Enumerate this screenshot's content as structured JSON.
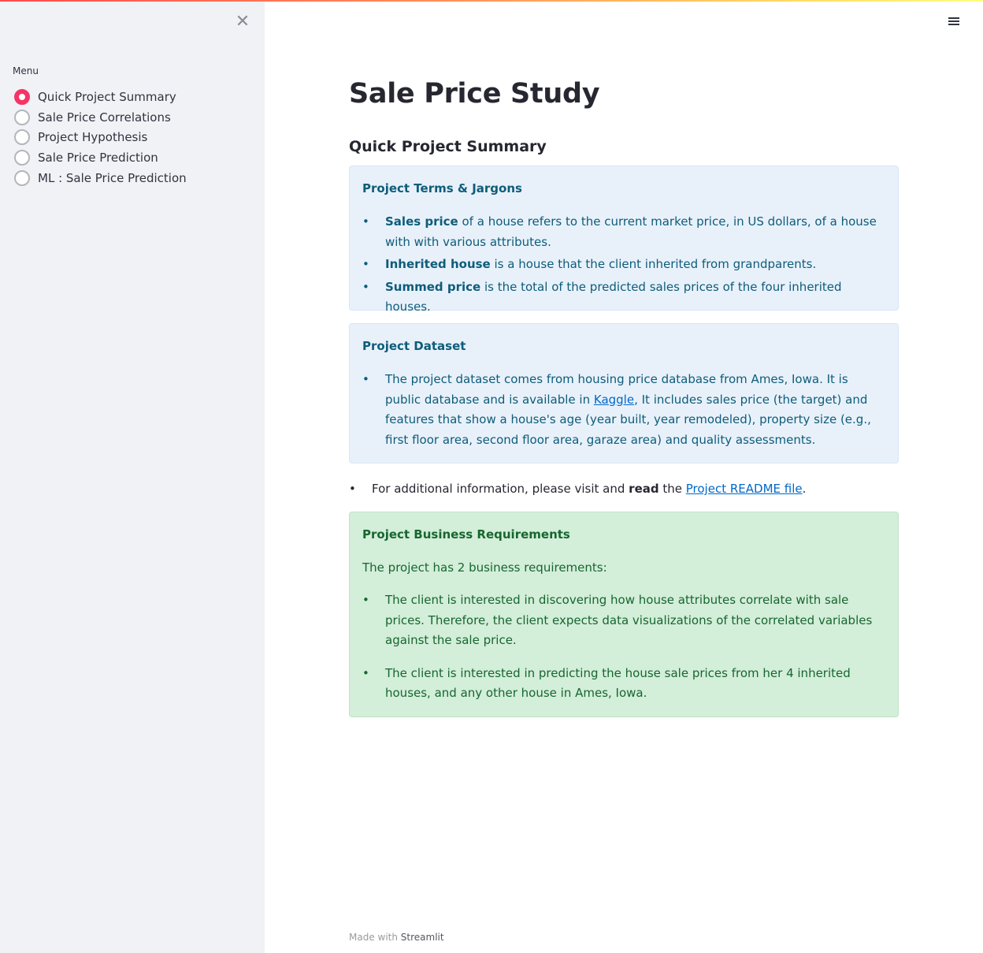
{
  "sidebar": {
    "close_glyph": "✕",
    "menu_label": "Menu",
    "items": [
      {
        "label": "Quick Project Summary",
        "selected": true
      },
      {
        "label": "Sale Price Correlations",
        "selected": false
      },
      {
        "label": "Project Hypothesis",
        "selected": false
      },
      {
        "label": "Sale Price Prediction",
        "selected": false
      },
      {
        "label": "ML : Sale Price Prediction",
        "selected": false
      }
    ]
  },
  "header": {
    "menu_icon": "hamburger-icon"
  },
  "main": {
    "title": "Sale Price Study",
    "section_title": "Quick Project Summary",
    "terms_box": {
      "title": "Project Terms & Jargons",
      "items": [
        {
          "bold": "Sales price",
          "text": " of a house refers to the current market price, in US dollars, of a house with with various attributes."
        },
        {
          "bold": "Inherited house",
          "text": " is a house that the client inherited from grandparents."
        },
        {
          "bold": "Summed price",
          "text": " is the total of the predicted sales prices of the four inherited houses."
        }
      ]
    },
    "dataset_box": {
      "title": "Project Dataset",
      "text_before": "The project dataset comes from housing price database from Ames, Iowa. It is public database and is available in ",
      "link": "Kaggle",
      "text_after": ", It includes sales price (the target) and features that show a house's age (year built, year remodeled), property size (e.g., first floor area, second floor area, garaze area) and quality assessments."
    },
    "additional": {
      "before": "For additional information, please visit and ",
      "bold": "read",
      "middle": " the ",
      "link": "Project README file",
      "after": "."
    },
    "requirements_box": {
      "title": "Project Business Requirements",
      "intro": "The project has 2 business requirements:",
      "items": [
        "The client is interested in discovering how house attributes correlate with sale prices. Therefore, the client expects data visualizations of the correlated variables against the sale price.",
        "The client is interested in predicting the house sale prices from her 4 inherited houses, and any other house in Ames, Iowa."
      ]
    }
  },
  "footer": {
    "prefix": "Made with ",
    "brand": "Streamlit"
  },
  "colors": {
    "accent": "#f63366",
    "sidebar_bg": "#f0f2f6",
    "info_bg": "#e8f1fa",
    "info_text": "#0e5c7a",
    "success_bg": "#d3eed9",
    "success_text": "#176630",
    "link": "#0068c9"
  }
}
